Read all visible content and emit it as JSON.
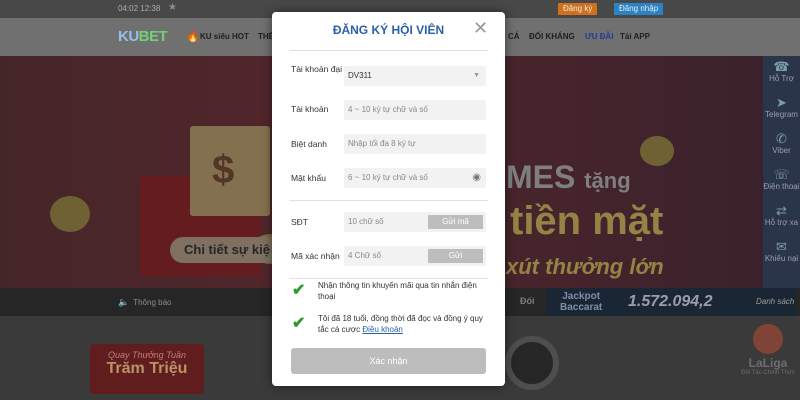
{
  "topbar": {
    "time": "04:02 12:38",
    "register": "Đăng ký",
    "login": "Đăng nhập"
  },
  "nav": {
    "logo_a": "KU",
    "logo_b": "BET",
    "hot": "KU siêu HOT",
    "the": "THỂ",
    "ca": "CÁ",
    "doi_khang": "ĐỐI KHÁNG",
    "uu_dai": "ƯU ĐÃI",
    "app": "Tải APP"
  },
  "banner": {
    "detail_button": "Chi tiết sự kiệ",
    "slogan1": "MES",
    "slogan1_b": "tặng",
    "slogan2": "tiền mặt",
    "slogan3": "xút thưởng lớn"
  },
  "ticker": {
    "notice": "Thông báo",
    "doi": "Đối"
  },
  "jackpot": {
    "label_1": "Jackpot",
    "label_2": "Baccarat",
    "value": "1.572.094,2",
    "list": "Danh sách"
  },
  "promo": {
    "line1": "Quay Thưởng Tuần",
    "line2": "Trăm Triệu"
  },
  "laliga": {
    "title": "LaLiga",
    "subtitle": "Đối Tác Chính Thức"
  },
  "side": {
    "items": [
      "Hỗ Trợ",
      "Telegram",
      "Viber",
      "Điện thoại",
      "Hỗ trợ xa",
      "Khiếu nại"
    ]
  },
  "modal": {
    "title": "ĐĂNG KÝ HỘI VIÊN",
    "agent_label": "Tài khoản đại lý",
    "agent_value": "DV311",
    "account_label": "Tài khoản",
    "account_placeholder": "4 ~ 10 ký tự chữ và số",
    "nickname_label": "Biệt danh",
    "nickname_placeholder": "Nhập tối đa 8 ký tự",
    "password_label": "Mật khẩu",
    "password_placeholder": "6 ~ 10 ký tự chữ và số",
    "phone_label": "SĐT",
    "phone_placeholder": "10 chữ số",
    "send_code": "Gửi mã",
    "verify_label": "Mã xác nhận",
    "verify_placeholder": "4 Chữ số",
    "send": "Gửi",
    "check1": "Nhận thông tin khuyến mãi qua tin nhắn điện thoại",
    "check2_text": "Tôi đã 18 tuổi, đồng thời đã đọc và đồng ý quy tắc cá cược",
    "check2_link": "Điều khoản",
    "submit": "Xác nhận"
  }
}
